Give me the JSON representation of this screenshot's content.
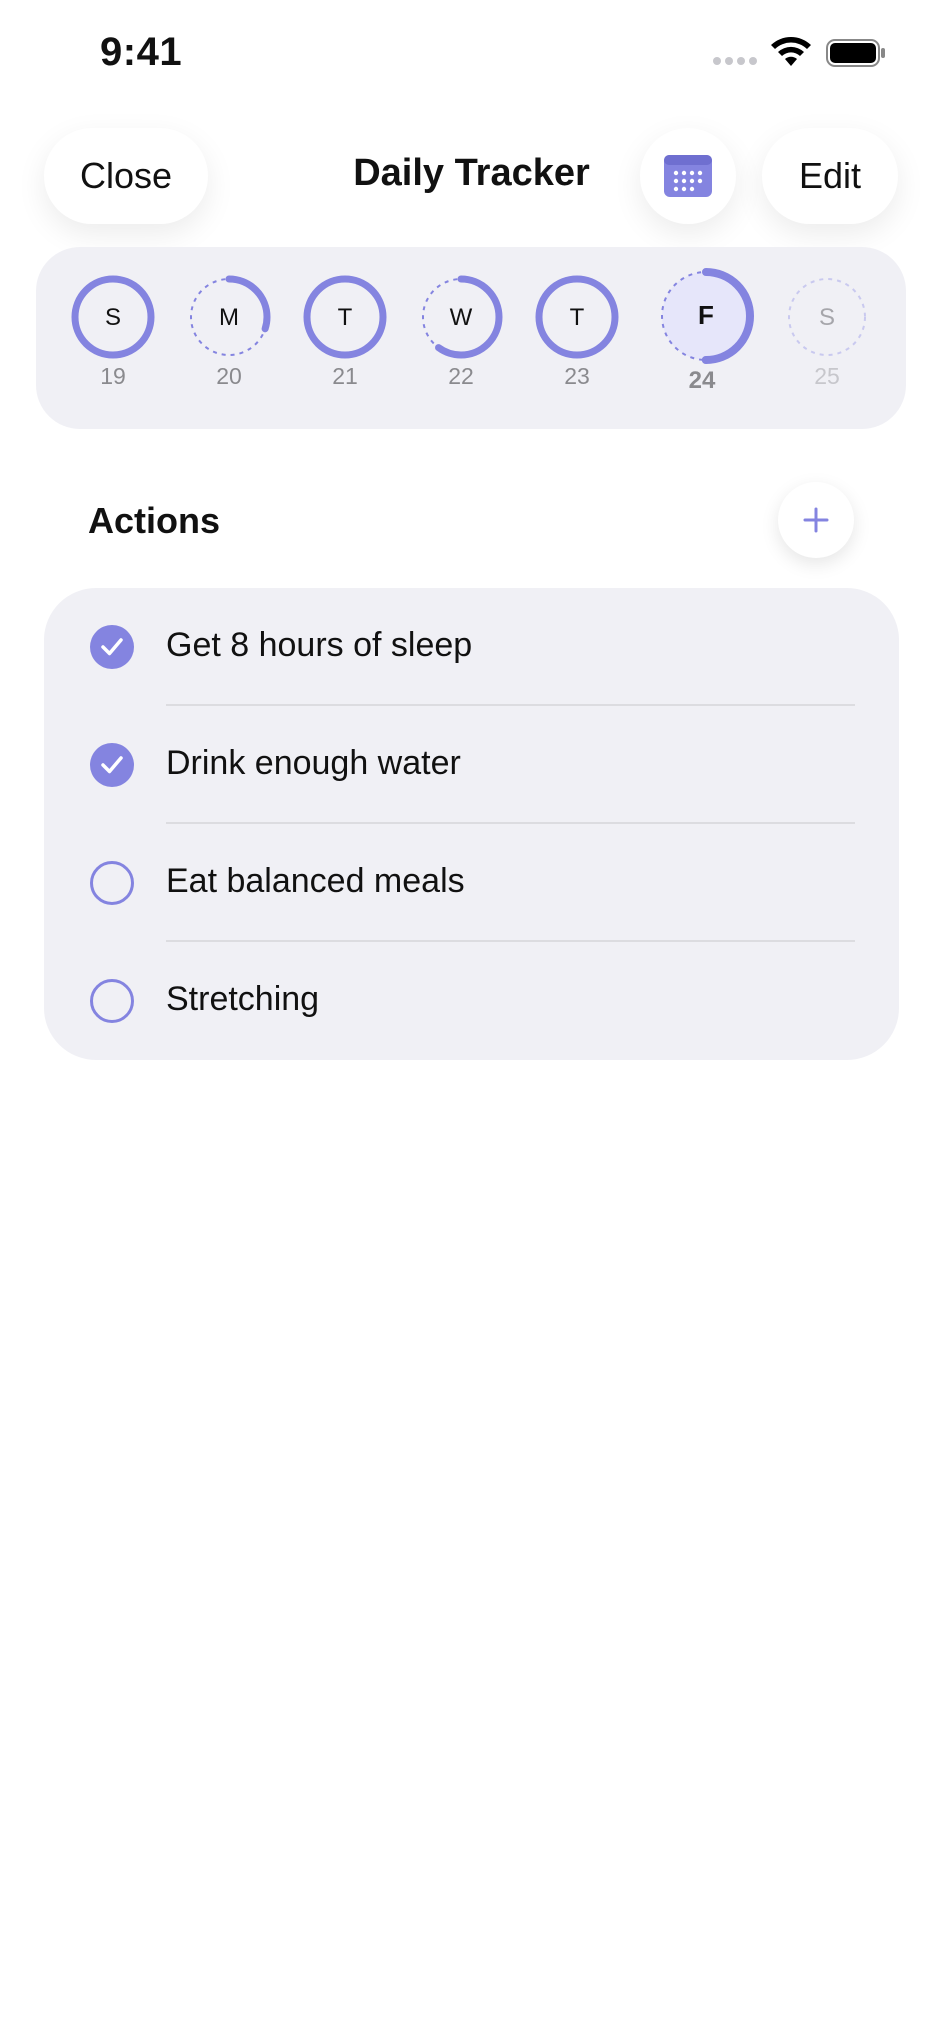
{
  "status_bar": {
    "time": "9:41"
  },
  "nav": {
    "close_label": "Close",
    "title": "Daily Tracker",
    "edit_label": "Edit",
    "calendar_icon": "calendar-icon"
  },
  "week": {
    "accent_color": "#8484e0",
    "days": [
      {
        "letter": "S",
        "date": "19",
        "progress": 1.0,
        "state": "past"
      },
      {
        "letter": "M",
        "date": "20",
        "progress": 0.3,
        "state": "past"
      },
      {
        "letter": "T",
        "date": "21",
        "progress": 1.0,
        "state": "past"
      },
      {
        "letter": "W",
        "date": "22",
        "progress": 0.6,
        "state": "past"
      },
      {
        "letter": "T",
        "date": "23",
        "progress": 1.0,
        "state": "past"
      },
      {
        "letter": "F",
        "date": "24",
        "progress": 0.5,
        "state": "today"
      },
      {
        "letter": "S",
        "date": "25",
        "progress": 0.0,
        "state": "future"
      }
    ]
  },
  "actions": {
    "title": "Actions",
    "add_icon": "plus-icon",
    "items": [
      {
        "label": "Get 8 hours of sleep",
        "done": true
      },
      {
        "label": "Drink enough water",
        "done": true
      },
      {
        "label": "Eat balanced meals",
        "done": false
      },
      {
        "label": "Stretching",
        "done": false
      }
    ]
  }
}
